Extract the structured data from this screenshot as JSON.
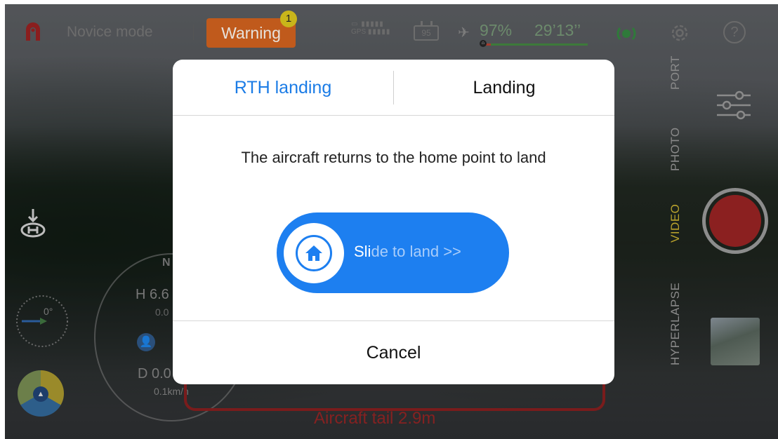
{
  "status_bar": {
    "mode_label": "Novice mode",
    "warning_label": "Warning",
    "warning_count": "1",
    "gps_label": "GPS",
    "battery_level": "95",
    "battery_percent": "97%",
    "flight_time": "29’13’’",
    "colors": {
      "warning": "#c05a1c",
      "battery_ok": "#3d7a3a",
      "battery_low": "#a63a2c"
    }
  },
  "camera_modes": [
    "PORT",
    "PHOTO",
    "VIDEO",
    "HYPERLAPSE"
  ],
  "active_camera_mode": "VIDEO",
  "telemetry": {
    "compass_angle": "0°",
    "heading_label": "N",
    "height_label": "H 6.6",
    "height_sub": "0.0",
    "distance_label": "D 0.0",
    "speed": "0.1km/h",
    "aircraft_tail": "Aircraft tail  2.9m"
  },
  "dialog": {
    "tabs": [
      "RTH landing",
      "Landing"
    ],
    "active_tab": "RTH landing",
    "description": "The aircraft returns to the home point to land",
    "slider_label_strong": "Sli",
    "slider_label_rest": "de to land >>",
    "cancel_label": "Cancel",
    "accent": "#1d7ff0"
  },
  "icons": [
    "app-logo",
    "signal-icon",
    "battery-icon",
    "aircraft-icon",
    "gps-icon",
    "gear-icon",
    "help-icon",
    "sliders-icon",
    "landing-icon",
    "home-icon",
    "person-icon"
  ]
}
